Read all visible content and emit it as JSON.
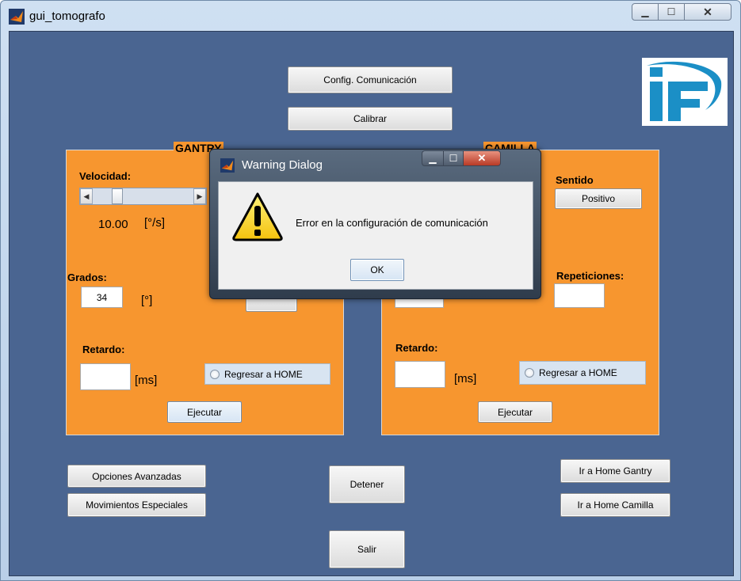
{
  "window": {
    "title": "gui_tomografo"
  },
  "top_buttons": {
    "config": "Config. Comunicación",
    "calibrar": "Calibrar"
  },
  "gantry": {
    "title": "GANTRY",
    "velocidad_label": "Velocidad:",
    "velocidad_value": "10.00",
    "velocidad_unit": "[°/s]",
    "grados_label": "Grados:",
    "grados_value": "34",
    "grados_unit": "[°]",
    "retardo_label": "Retardo:",
    "retardo_value": "",
    "retardo_unit": "[ms]",
    "home_label": "Regresar a HOME",
    "ejecutar": "Ejecutar"
  },
  "camilla": {
    "title": "CAMILLA",
    "sentido_label": "Sentido",
    "sentido_button": "Positivo",
    "repeticiones_label": "Repeticiones:",
    "repeticiones_value": "",
    "retardo_label": "Retardo:",
    "retardo_value": "",
    "retardo_unit": "[ms]",
    "home_label": "Regresar a HOME",
    "ejecutar": "Ejecutar"
  },
  "bottom_buttons": {
    "opciones": "Opciones Avanzadas",
    "movimientos": "Movimientos Especiales",
    "detener": "Detener",
    "salir": "Salir",
    "home_gantry": "Ir a Home Gantry",
    "home_camilla": "Ir a Home Camilla"
  },
  "dialog": {
    "title": "Warning Dialog",
    "message": "Error en la configuración de comunicación",
    "ok": "OK"
  },
  "colors": {
    "background": "#4a6591",
    "panel": "#f7962f",
    "logo_blue": "#1b8fc6"
  }
}
